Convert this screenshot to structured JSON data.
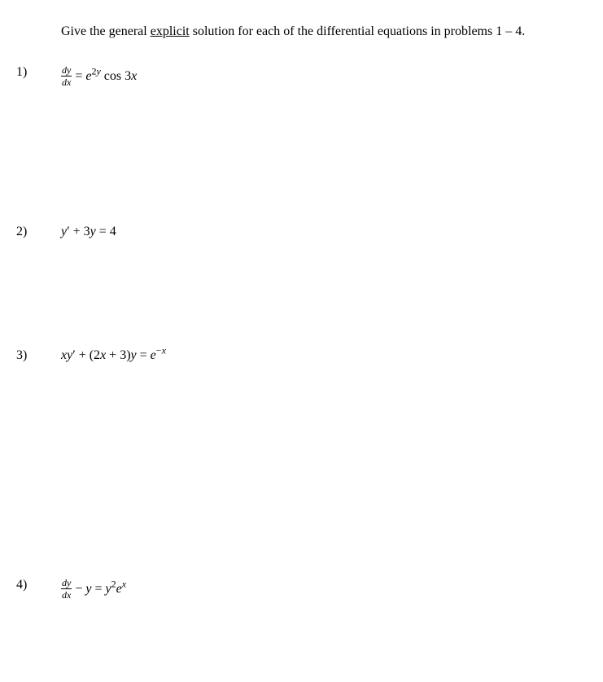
{
  "instructions": {
    "prefix": "Give the general ",
    "underlined": "explicit",
    "suffix": " solution for each of the differential equations in problems 1 – 4."
  },
  "problems": [
    {
      "number": "1)",
      "equation_html": "<span class=\"fraction\"><span class=\"num\">dy</span><span class=\"den\">dx</span></span> <span class=\"eq-text\">= <span class=\"math-italic\">e</span><sup>2<span class=\"math-italic\">y</span></sup> cos 3<span class=\"math-italic\">x</span></span>"
    },
    {
      "number": "2)",
      "equation_html": "<span class=\"math-italic\">y</span>&prime; + 3<span class=\"math-italic\">y</span> = 4"
    },
    {
      "number": "3)",
      "equation_html": "<span class=\"math-italic\">xy</span>&prime; + (2<span class=\"math-italic\">x</span> + 3)<span class=\"math-italic\">y</span> = <span class=\"math-italic\">e</span><sup>&minus;<span class=\"math-italic\">x</span></sup>"
    },
    {
      "number": "4)",
      "equation_html": "<span class=\"fraction\"><span class=\"num\">dy</span><span class=\"den\">dx</span></span> <span class=\"eq-text\">&minus; <span class=\"math-italic\">y</span> = <span class=\"math-italic\">y</span><sup>2</sup><span class=\"math-italic\">e</span><sup><span class=\"math-italic\">x</span></sup></span>"
    }
  ]
}
